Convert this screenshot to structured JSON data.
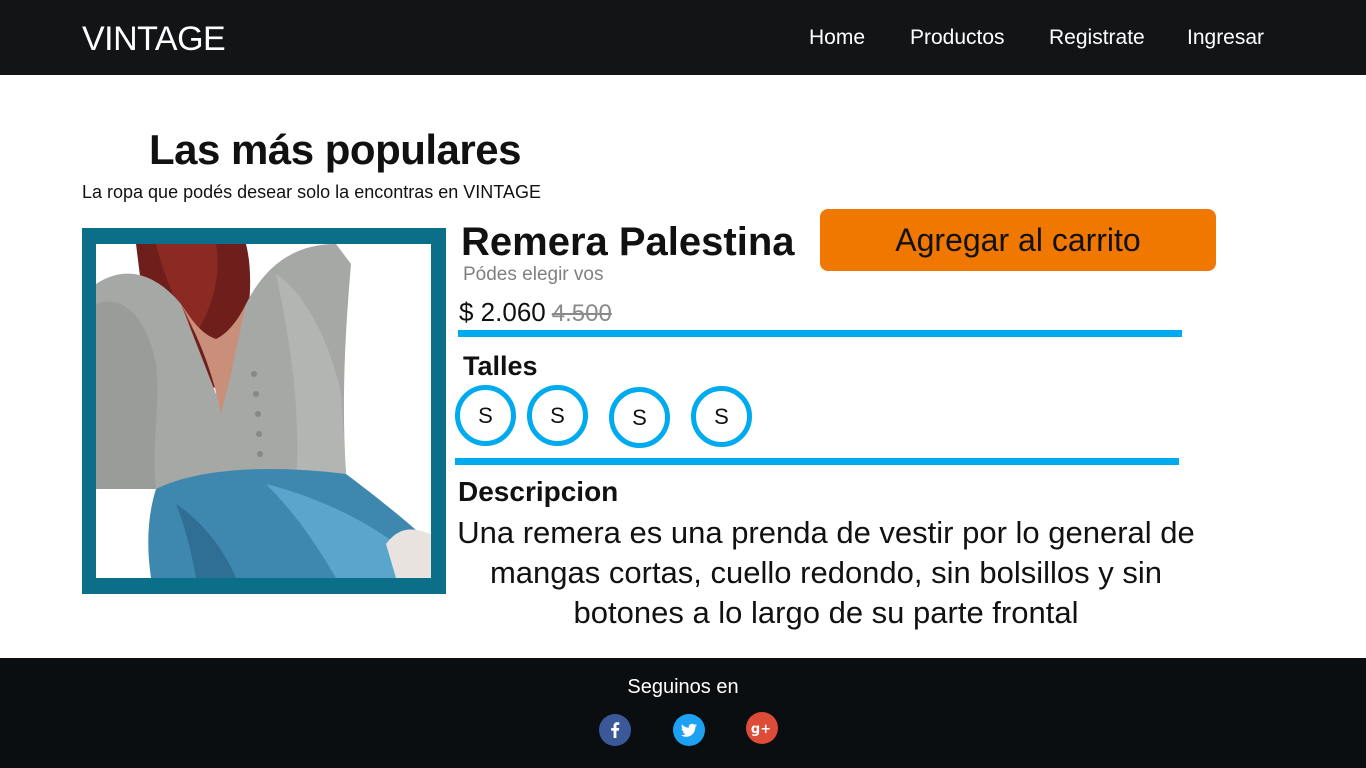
{
  "header": {
    "brand": "VINTAGE",
    "nav": [
      "Home",
      "Productos",
      "Registrate",
      "Ingresar"
    ]
  },
  "section": {
    "title": "Las más populares",
    "subtitle": "La ropa que podés desear solo la encontras en VINTAGE"
  },
  "product": {
    "name": "Remera Palestina",
    "note": "Pódes elegir vos",
    "price": "$ 2.060",
    "old_price": "4.500",
    "add_to_cart": "Agregar al carrito",
    "sizes_title": "Talles",
    "sizes": [
      "S",
      "S",
      "S",
      "S"
    ],
    "description_title": "Descripcion",
    "description": "Una remera es una prenda de vestir por lo general de mangas cortas, cuello redondo, sin bolsillos y sin botones a lo largo de su parte frontal"
  },
  "footer": {
    "follow": "Seguinos en",
    "social": [
      "facebook-icon",
      "twitter-icon",
      "google-plus-icon"
    ]
  },
  "colors": {
    "header_bg": "#121416",
    "footer_bg": "#0b0e11",
    "accent_blue": "#00aaee",
    "image_frame": "#0b6f8a",
    "cta_orange": "#f07800"
  }
}
